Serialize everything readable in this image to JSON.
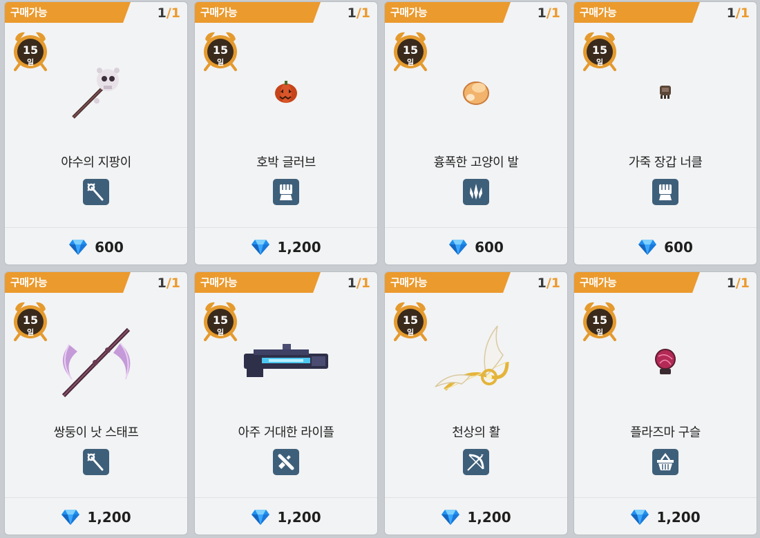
{
  "items": [
    {
      "tag": "구매가능",
      "count_current": "1",
      "count_max": "1",
      "timer_value": "15",
      "timer_unit": "일",
      "name": "야수의 지팡이",
      "type_icon": "staff-icon",
      "price": "600",
      "art": "skull-staff-icon"
    },
    {
      "tag": "구매가능",
      "count_current": "1",
      "count_max": "1",
      "timer_value": "15",
      "timer_unit": "일",
      "name": "호박 글러브",
      "type_icon": "fist-icon",
      "price": "1,200",
      "art": "pumpkin-glove-icon"
    },
    {
      "tag": "구매가능",
      "count_current": "1",
      "count_max": "1",
      "timer_value": "15",
      "timer_unit": "일",
      "name": "흉폭한 고양이 발",
      "type_icon": "claw-icon",
      "price": "600",
      "art": "cat-paw-icon"
    },
    {
      "tag": "구매가능",
      "count_current": "1",
      "count_max": "1",
      "timer_value": "15",
      "timer_unit": "일",
      "name": "가죽 장갑 너클",
      "type_icon": "fist-icon",
      "price": "600",
      "art": "leather-knuckle-icon"
    },
    {
      "tag": "구매가능",
      "count_current": "1",
      "count_max": "1",
      "timer_value": "15",
      "timer_unit": "일",
      "name": "쌍둥이 낫 스태프",
      "type_icon": "staff-icon",
      "price": "1,200",
      "art": "twin-scythe-icon"
    },
    {
      "tag": "구매가능",
      "count_current": "1",
      "count_max": "1",
      "timer_value": "15",
      "timer_unit": "일",
      "name": "아주 거대한 라이플",
      "type_icon": "gun-icon",
      "price": "1,200",
      "art": "rifle-icon"
    },
    {
      "tag": "구매가능",
      "count_current": "1",
      "count_max": "1",
      "timer_value": "15",
      "timer_unit": "일",
      "name": "천상의 활",
      "type_icon": "bow-icon",
      "price": "1,200",
      "art": "winged-bow-icon"
    },
    {
      "tag": "구매가능",
      "count_current": "1",
      "count_max": "1",
      "timer_value": "15",
      "timer_unit": "일",
      "name": "플라즈마 구슬",
      "type_icon": "basket-icon",
      "price": "1,200",
      "art": "plasma-orb-icon"
    }
  ],
  "colors": {
    "tag_bg": "#eb9a2d",
    "type_icon_bg": "#3e5f7a",
    "gem": "#2a9df4"
  }
}
